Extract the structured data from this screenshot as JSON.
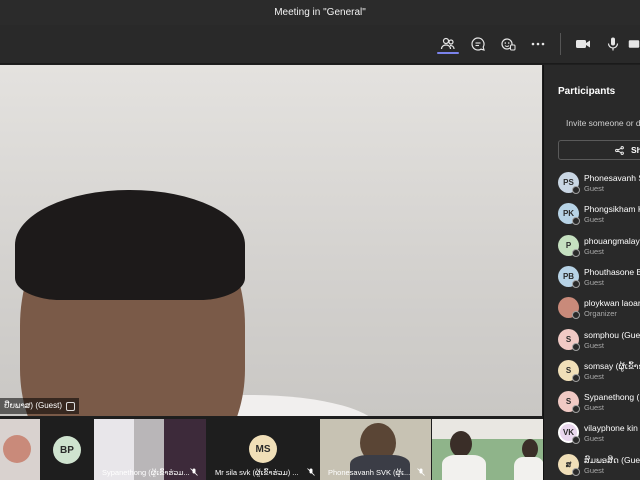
{
  "window": {
    "title": "Meeting in \"General\""
  },
  "toolbar": {
    "items": [
      {
        "icon": "people-icon",
        "active": true
      },
      {
        "icon": "chat-icon"
      },
      {
        "icon": "react-icon"
      },
      {
        "icon": "more-icon"
      },
      {
        "icon": "camera-icon"
      },
      {
        "icon": "mic-icon"
      },
      {
        "icon": "share-tray-icon"
      }
    ]
  },
  "main_video": {
    "name_tag": "ຢື່ຍພາສ) (Guest)"
  },
  "participants_panel": {
    "title": "Participants",
    "invite_text": "Invite someone or d",
    "share_label": "Sh",
    "people": [
      {
        "initials": "PS",
        "name": "Phonesavanh S",
        "role": "Guest",
        "avatar_color": "#c9d6e3"
      },
      {
        "initials": "PK",
        "name": "Phongsikham K",
        "role": "Guest",
        "avatar_color": "#b7d3e6"
      },
      {
        "initials": "P",
        "name": "phouangmalay",
        "role": "Guest",
        "avatar_color": "#c5e0c0"
      },
      {
        "initials": "PB",
        "name": "Phouthasone B",
        "role": "Guest",
        "avatar_color": "#b7d3e6"
      },
      {
        "initials": "",
        "name": "ploykwan laoar",
        "role": "Organizer",
        "avatar_color": "#c98a7a"
      },
      {
        "initials": "S",
        "name": "somphou (Gue",
        "role": "Guest",
        "avatar_color": "#f0c9c4"
      },
      {
        "initials": "S",
        "name": "somsay (ຜູ້ເຂົ້າຮ່ວມ",
        "role": "Guest",
        "avatar_color": "#f0dfb8"
      },
      {
        "initials": "S",
        "name": "Sypanethong (",
        "role": "Guest",
        "avatar_color": "#f0c9c4"
      },
      {
        "initials": "VK",
        "name": "vilayphone kin",
        "role": "Guest",
        "avatar_color": "#e9d7ee"
      },
      {
        "initials": "ສ",
        "name": "ສົມພອສິດ (Gues",
        "role": "Guest",
        "avatar_color": "#f0dfb8"
      }
    ]
  },
  "video_strip": {
    "tiles": [
      {
        "kind": "photo",
        "name": ""
      },
      {
        "kind": "avatar",
        "initials": "BP",
        "name": "",
        "avatar_color": "#cfe3cf"
      },
      {
        "kind": "video",
        "name": "Sypanethong (ຜູ້ເຂົ້າຮ່ວມ..."
      },
      {
        "kind": "avatar",
        "initials": "MS",
        "name": "Mr sila svk (ຜູ້ເຂົ້າຮ່ວມ) ...",
        "avatar_color": "#f0dfb8"
      },
      {
        "kind": "video",
        "name": "Phonesavanh SVK (ຜູ້ເ..."
      },
      {
        "kind": "video",
        "name": ""
      }
    ]
  },
  "colors": {
    "accent": "#7b83eb",
    "background": "#1f1f1f",
    "panel": "#292929"
  }
}
